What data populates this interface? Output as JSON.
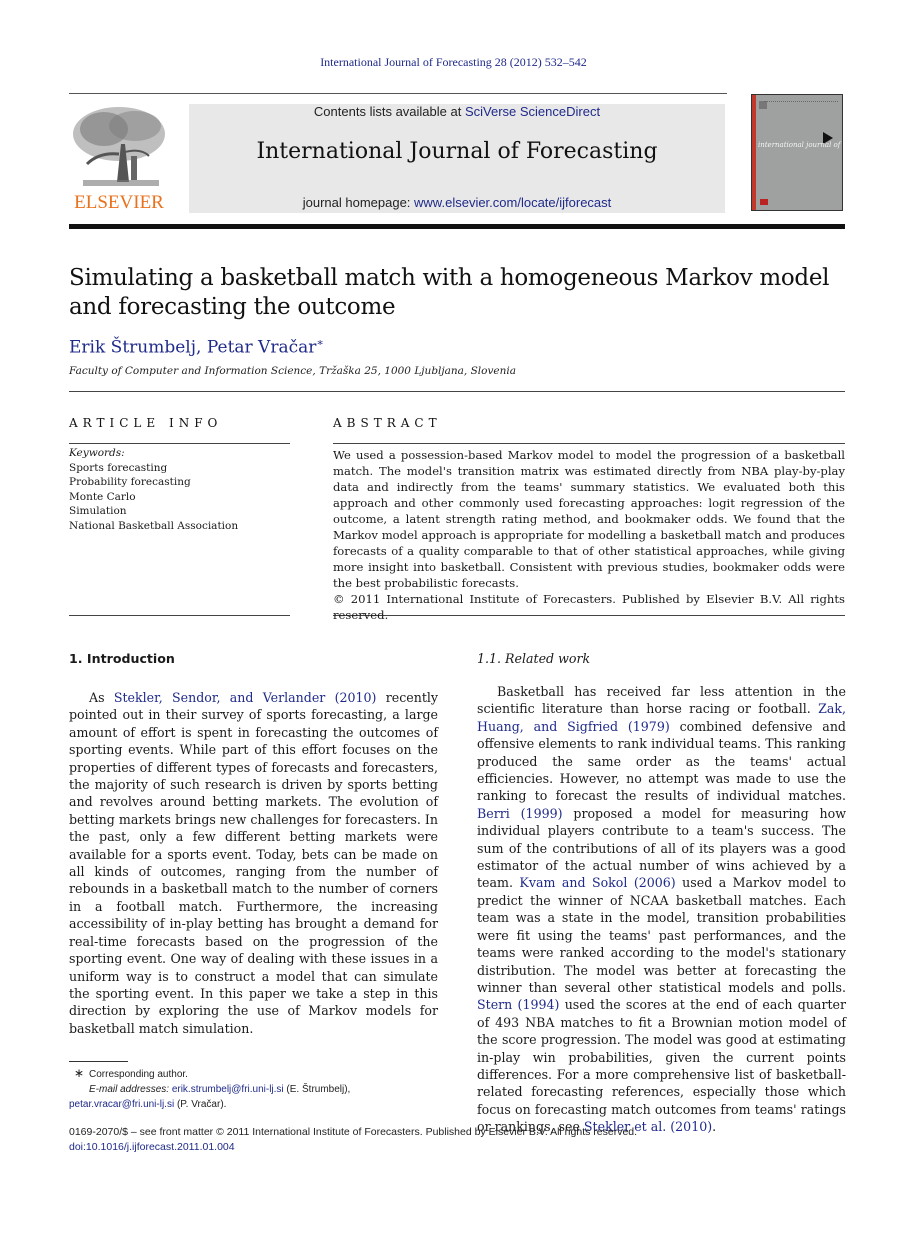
{
  "running_head": "International Journal of Forecasting 28 (2012) 532–542",
  "header": {
    "publisher_logo_text": "ELSEVIER",
    "contents_prefix": "Contents lists available at ",
    "contents_link": "SciVerse ScienceDirect",
    "journal_title": "International Journal of Forecasting",
    "homepage_prefix": "journal homepage: ",
    "homepage_link": "www.elsevier.com/locate/ijforecast",
    "cover_title": "international journal of forecasting"
  },
  "article": {
    "title": "Simulating a basketball match with a homogeneous Markov model and forecasting the outcome",
    "authors": [
      {
        "name": "Erik Štrumbelj",
        "sep": ", "
      },
      {
        "name": "Petar Vračar",
        "mark": "∗"
      }
    ],
    "affiliation": "Faculty of Computer and Information Science, Tržaška 25, 1000 Ljubljana, Slovenia"
  },
  "article_info": {
    "heading": "ARTICLE INFO",
    "keywords_label": "Keywords:",
    "keywords": [
      "Sports forecasting",
      "Probability forecasting",
      "Monte Carlo",
      "Simulation",
      "National Basketball Association"
    ]
  },
  "abstract": {
    "heading": "ABSTRACT",
    "text": "We used a possession-based Markov model to model the progression of a basketball match. The model's transition matrix was estimated directly from NBA play-by-play data and indirectly from the teams' summary statistics. We evaluated both this approach and other commonly used forecasting approaches: logit regression of the outcome, a latent strength rating method, and bookmaker odds. We found that the Markov model approach is appropriate for modelling a basketball match and produces forecasts of a quality comparable to that of other statistical approaches, while giving more insight into basketball. Consistent with previous studies, bookmaker odds were the best probabilistic forecasts.",
    "copyright": "© 2011 International Institute of Forecasters. Published by Elsevier B.V. All rights reserved."
  },
  "intro": {
    "heading": "1.  Introduction",
    "p1_before": "As ",
    "p1_link": "Stekler, Sendor, and Verlander (2010)",
    "p1_after": " recently pointed out in their survey of sports forecasting, a large amount of effort is spent in forecasting the outcomes of sporting events. While part of this effort focuses on the properties of different types of forecasts and forecasters, the majority of such research is driven by sports betting and revolves around betting markets. The evolution of betting markets brings new challenges for forecasters. In the past, only a few different betting markets were available for a sports event. Today, bets can be made on all kinds of outcomes, ranging from the number of rebounds in a basketball match to the number of corners in a football match. Furthermore, the increasing accessibility of in-play betting has brought a demand for real-time forecasts based on the progression of the sporting event. One way of dealing with these issues in a uniform way is to construct a model that can simulate the sporting event. In this paper we take a step in this direction by exploring the use of Markov models for basketball match simulation."
  },
  "related": {
    "heading": "1.1.  Related work",
    "s1": "Basketball has received far less attention in the scientific literature than horse racing or football. ",
    "l1": "Zak, Huang, and Sigfried (1979)",
    "s2": " combined defensive and offensive elements to rank individual teams. This ranking produced the same order as the teams' actual efficiencies. However, no attempt was made to use the ranking to forecast the results of individual matches. ",
    "l2": "Berri (1999)",
    "s3": " proposed a model for measuring how individual players contribute to a team's success. The sum of the contributions of all of its players was a good estimator of the actual number of wins achieved by a team. ",
    "l3": "Kvam and Sokol (2006)",
    "s4": " used a Markov model to predict the winner of NCAA basketball matches. Each team was a state in the model, transition probabilities were fit using the teams' past performances, and the teams were ranked according to the model's stationary distribution. The model was better at forecasting the winner than several other statistical models and polls. ",
    "l4": "Stern (1994)",
    "s5": " used the scores at the end of each quarter of 493 NBA matches to fit a Brownian motion model of the score progression. The model was good at estimating in-play win probabilities, given the current points differences. For a more comprehensive list of basketball-related forecasting references, especially those which focus on forecasting match outcomes from teams' ratings or rankings, see ",
    "l5": "Stekler et al. (2010)",
    "s6": "."
  },
  "footnote": {
    "star": "∗",
    "corresponding": "Corresponding author.",
    "email_label": "E-mail addresses: ",
    "email1": "erik.strumbelj@fri.uni-lj.si",
    "email1_who": " (E. Štrumbelj),",
    "email2": "petar.vracar@fri.uni-lj.si",
    "email2_who": " (P. Vračar)."
  },
  "bottom": {
    "issn_line": "0169-2070/$ – see front matter © 2011 International Institute of Forecasters. Published by Elsevier B.V. All rights reserved.",
    "doi": "doi:10.1016/j.ijforecast.2011.01.004"
  },
  "colors": {
    "link": "#1f2a8a",
    "elsevier_orange": "#e9711c",
    "banner_gray": "#e8e8e8",
    "cover_gray": "#9fa0a0"
  }
}
